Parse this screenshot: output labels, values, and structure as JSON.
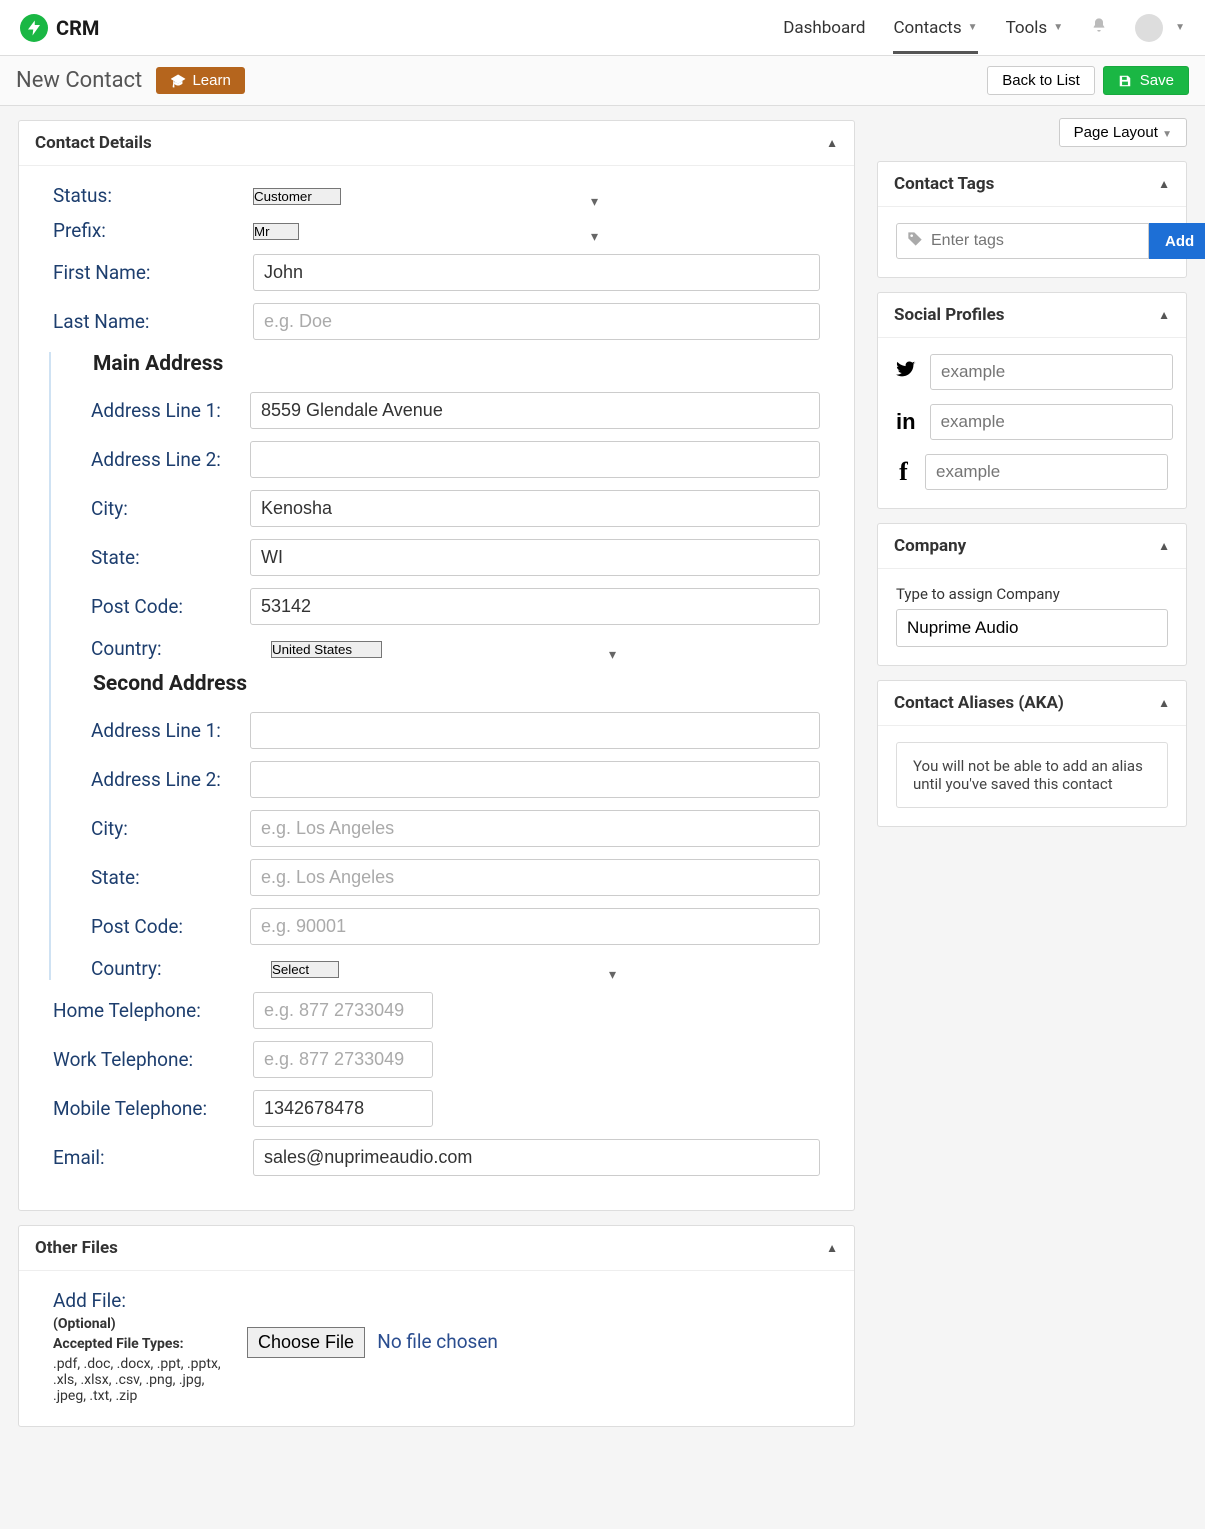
{
  "brand": {
    "name": "CRM"
  },
  "nav": {
    "dashboard": "Dashboard",
    "contacts": "Contacts",
    "tools": "Tools"
  },
  "subheader": {
    "title": "New Contact",
    "learn": "Learn",
    "back": "Back to List",
    "save": "Save",
    "page_layout": "Page Layout"
  },
  "panels": {
    "contact_details": "Contact Details",
    "other_files": "Other Files",
    "contact_tags": "Contact Tags",
    "social": "Social Profiles",
    "company": "Company",
    "aliases": "Contact Aliases (AKA)"
  },
  "form": {
    "labels": {
      "status": "Status:",
      "prefix": "Prefix:",
      "first_name": "First Name:",
      "last_name": "Last Name:",
      "main_addr": "Main Address",
      "second_addr": "Second Address",
      "addr1": "Address Line 1:",
      "addr2": "Address Line 2:",
      "city": "City:",
      "state": "State:",
      "post": "Post Code:",
      "country": "Country:",
      "home_tel": "Home Telephone:",
      "work_tel": "Work Telephone:",
      "mobile_tel": "Mobile Telephone:",
      "email": "Email:"
    },
    "values": {
      "status": "Customer",
      "prefix": "Mr",
      "first_name": "John",
      "last_name": "",
      "main": {
        "addr1": "8559 Glendale Avenue",
        "addr2": "",
        "city": "Kenosha",
        "state": "WI",
        "post": "53142",
        "country": "United States"
      },
      "second": {
        "addr1": "",
        "addr2": "",
        "city": "",
        "state": "",
        "post": "",
        "country": "Select"
      },
      "home_tel": "",
      "work_tel": "",
      "mobile_tel": "1342678478",
      "email": "sales@nuprimeaudio.com"
    },
    "placeholders": {
      "last_name": "e.g. Doe",
      "city2": "e.g. Los Angeles",
      "state2": "e.g. Los Angeles",
      "post2": "e.g. 90001",
      "tel": "e.g. 877 2733049"
    }
  },
  "files": {
    "add_file": "Add File:",
    "optional": "(Optional)",
    "types_label": "Accepted File Types:",
    "types": ".pdf, .doc, .docx, .ppt, .pptx, .xls, .xlsx, .csv, .png, .jpg, .jpeg, .txt, .zip",
    "choose": "Choose File",
    "nofile": "No file chosen"
  },
  "tags": {
    "placeholder": "Enter tags",
    "add": "Add"
  },
  "social": {
    "placeholder": "example"
  },
  "company": {
    "label": "Type to assign Company",
    "value": "Nuprime Audio"
  },
  "aliases": {
    "note": "You will not be able to add an alias until you've saved this contact"
  }
}
